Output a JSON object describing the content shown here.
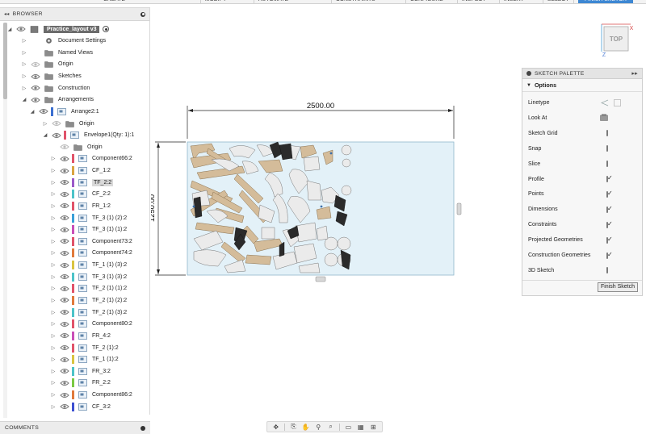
{
  "toolbar": {
    "items": [
      {
        "label": "CREATE",
        "active": false
      },
      {
        "label": "MODIFY",
        "active": false
      },
      {
        "label": "AUTOMATE",
        "active": false
      },
      {
        "label": "CONSTRAINTS",
        "active": false
      },
      {
        "label": "CONFIGURE",
        "active": false
      },
      {
        "label": "INSPECT",
        "active": false
      },
      {
        "label": "INSERT",
        "active": false
      },
      {
        "label": "SELECT",
        "active": false
      },
      {
        "label": "FINISH SKETCH",
        "active": true
      }
    ]
  },
  "browser": {
    "title": "BROWSER",
    "rows": [
      {
        "label": "Practice_layout v3",
        "icon": "document-icon",
        "expand": "open",
        "eye": true,
        "indent": 0,
        "root": true
      },
      {
        "label": "Document Settings",
        "icon": "gear-icon",
        "expand": "closed",
        "eye": false,
        "indent": 1
      },
      {
        "label": "Named Views",
        "icon": "folder-icon",
        "expand": "closed",
        "eye": false,
        "indent": 1
      },
      {
        "label": "Origin",
        "icon": "folder-icon",
        "expand": "closed",
        "eye": true,
        "eyeDim": true,
        "indent": 1
      },
      {
        "label": "Sketches",
        "icon": "folder-icon",
        "expand": "closed",
        "eye": true,
        "indent": 1
      },
      {
        "label": "Construction",
        "icon": "folder-icon",
        "expand": "closed",
        "eye": true,
        "indent": 1
      },
      {
        "label": "Arrangements",
        "icon": "folder-icon",
        "expand": "open",
        "eye": true,
        "indent": 1
      },
      {
        "label": "Arrange2:1",
        "icon": "component-icon",
        "expand": "open",
        "eye": true,
        "indent": 2,
        "color": "#3b6fd1"
      },
      {
        "label": "Origin",
        "icon": "folder-icon",
        "expand": "closed",
        "eye": true,
        "eyeDim": true,
        "indent": 3
      },
      {
        "label": "Envelope1(Qty:  1):1",
        "icon": "component-icon",
        "expand": "open",
        "eye": true,
        "indent": 3,
        "color": "#e0536a"
      },
      {
        "label": "Origin",
        "icon": "folder-icon",
        "expand": "none",
        "eye": true,
        "eyeDim": true,
        "indent": 4
      },
      {
        "label": "Component66:2",
        "icon": "component-icon",
        "expand": "closed",
        "eye": true,
        "indent": 4,
        "color": "#e0536a"
      },
      {
        "label": "CF_1:2",
        "icon": "component-icon",
        "expand": "closed",
        "eye": true,
        "indent": 4,
        "color": "#d9a441"
      },
      {
        "label": "TF_2:2",
        "icon": "component-icon",
        "expand": "closed",
        "eye": true,
        "indent": 4,
        "color": "#9b59c9",
        "selected": true
      },
      {
        "label": "CF_2:2",
        "icon": "component-icon",
        "expand": "closed",
        "eye": true,
        "indent": 4,
        "color": "#4cc3c9"
      },
      {
        "label": "FR_1:2",
        "icon": "component-icon",
        "expand": "closed",
        "eye": true,
        "indent": 4,
        "color": "#e0536a"
      },
      {
        "label": "TF_3 (1) (2):2",
        "icon": "component-icon",
        "expand": "closed",
        "eye": true,
        "indent": 4,
        "color": "#3aa0d8"
      },
      {
        "label": "TF_3 (1) (1):2",
        "icon": "component-icon",
        "expand": "closed",
        "eye": true,
        "indent": 4,
        "color": "#c94fb8"
      },
      {
        "label": "Component73:2",
        "icon": "component-icon",
        "expand": "closed",
        "eye": true,
        "indent": 4,
        "color": "#e0536a"
      },
      {
        "label": "Component74:2",
        "icon": "component-icon",
        "expand": "closed",
        "eye": true,
        "indent": 4,
        "color": "#e07a3b"
      },
      {
        "label": "TF_1 (1) (3):2",
        "icon": "component-icon",
        "expand": "closed",
        "eye": true,
        "indent": 4,
        "color": "#d9c441"
      },
      {
        "label": "TF_3 (1) (3):2",
        "icon": "component-icon",
        "expand": "closed",
        "eye": true,
        "indent": 4,
        "color": "#4cc3c9"
      },
      {
        "label": "TF_2 (1) (1):2",
        "icon": "component-icon",
        "expand": "closed",
        "eye": true,
        "indent": 4,
        "color": "#e0536a"
      },
      {
        "label": "TF_2 (1) (2):2",
        "icon": "component-icon",
        "expand": "closed",
        "eye": true,
        "indent": 4,
        "color": "#e07a3b"
      },
      {
        "label": "TF_2 (1) (3):2",
        "icon": "component-icon",
        "expand": "closed",
        "eye": true,
        "indent": 4,
        "color": "#4cc3c9"
      },
      {
        "label": "Component80:2",
        "icon": "component-icon",
        "expand": "closed",
        "eye": true,
        "indent": 4,
        "color": "#e0536a"
      },
      {
        "label": "FR_4:2",
        "icon": "component-icon",
        "expand": "closed",
        "eye": true,
        "indent": 4,
        "color": "#c94fb8"
      },
      {
        "label": "TF_2 (1):2",
        "icon": "component-icon",
        "expand": "closed",
        "eye": true,
        "indent": 4,
        "color": "#e0536a"
      },
      {
        "label": "TF_1 (1):2",
        "icon": "component-icon",
        "expand": "closed",
        "eye": true,
        "indent": 4,
        "color": "#d9c441"
      },
      {
        "label": "FR_3:2",
        "icon": "component-icon",
        "expand": "closed",
        "eye": true,
        "indent": 4,
        "color": "#4cc3c9"
      },
      {
        "label": "FR_2:2",
        "icon": "component-icon",
        "expand": "closed",
        "eye": true,
        "indent": 4,
        "color": "#7ac943"
      },
      {
        "label": "Component86:2",
        "icon": "component-icon",
        "expand": "closed",
        "eye": true,
        "indent": 4,
        "color": "#e07a3b"
      },
      {
        "label": "CF_3:2",
        "icon": "component-icon",
        "expand": "closed",
        "eye": true,
        "indent": 4,
        "color": "#3b4fd1"
      }
    ]
  },
  "comments": {
    "title": "COMMENTS"
  },
  "canvas": {
    "width_dimension": "2500.00",
    "height_dimension": "1250.00"
  },
  "viewcube": {
    "face": "TOP",
    "axis_x": "X",
    "axis_z": "Z"
  },
  "palette": {
    "title": "SKETCH PALETTE",
    "section": "Options",
    "options": [
      {
        "label": "Linetype",
        "control": "linetype"
      },
      {
        "label": "Look At",
        "control": "lookat"
      },
      {
        "label": "Sketch Grid",
        "control": "checkbox",
        "checked": false
      },
      {
        "label": "Snap",
        "control": "checkbox",
        "checked": false
      },
      {
        "label": "Slice",
        "control": "checkbox",
        "checked": false
      },
      {
        "label": "Profile",
        "control": "checkbox",
        "checked": true
      },
      {
        "label": "Points",
        "control": "checkbox",
        "checked": true
      },
      {
        "label": "Dimensions",
        "control": "checkbox",
        "checked": true
      },
      {
        "label": "Constraints",
        "control": "checkbox",
        "checked": true
      },
      {
        "label": "Projected Geometries",
        "control": "checkbox",
        "checked": true
      },
      {
        "label": "Construction Geometries",
        "control": "checkbox",
        "checked": true
      },
      {
        "label": "3D Sketch",
        "control": "checkbox",
        "checked": false
      }
    ],
    "finish_label": "Finish Sketch"
  },
  "colors": {
    "sheet_fill": "#e3f1f8",
    "part_wood": "#d4bc9a",
    "part_light": "#ebebeb",
    "part_dark": "#2b2b2b",
    "accent": "#3d87d3"
  },
  "navbar": {
    "icons": [
      "orbit-icon",
      "pan-camera-icon",
      "hand-pan-icon",
      "zoom-icon",
      "zoom-window-icon",
      "display-style-icon",
      "grid-icon",
      "viewports-icon"
    ]
  }
}
